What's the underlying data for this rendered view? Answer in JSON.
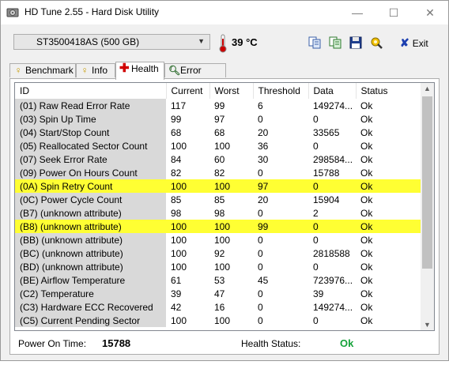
{
  "window": {
    "title": "HD Tune 2.55 - Hard Disk Utility",
    "controls": {
      "minimize": "—",
      "maximize": "☐",
      "close": "✕"
    }
  },
  "toolbar": {
    "drive": "ST3500418AS (500 GB)",
    "temperature": "39 °C",
    "exit_label": "Exit"
  },
  "tabs": [
    {
      "label": "Benchmark",
      "icon": "benchmark-icon"
    },
    {
      "label": "Info",
      "icon": "info-icon"
    },
    {
      "label": "Health",
      "icon": "health-icon",
      "active": true
    },
    {
      "label": "Error Scan",
      "icon": "error-scan-icon"
    }
  ],
  "table": {
    "columns": [
      "ID",
      "Current",
      "Worst",
      "Threshold",
      "Data",
      "Status"
    ],
    "rows": [
      {
        "id": "(01) Raw Read Error Rate",
        "current": "117",
        "worst": "99",
        "threshold": "6",
        "data": "149274...",
        "status": "Ok"
      },
      {
        "id": "(03) Spin Up Time",
        "current": "99",
        "worst": "97",
        "threshold": "0",
        "data": "0",
        "status": "Ok"
      },
      {
        "id": "(04) Start/Stop Count",
        "current": "68",
        "worst": "68",
        "threshold": "20",
        "data": "33565",
        "status": "Ok"
      },
      {
        "id": "(05) Reallocated Sector Count",
        "current": "100",
        "worst": "100",
        "threshold": "36",
        "data": "0",
        "status": "Ok"
      },
      {
        "id": "(07) Seek Error Rate",
        "current": "84",
        "worst": "60",
        "threshold": "30",
        "data": "298584...",
        "status": "Ok"
      },
      {
        "id": "(09) Power On Hours Count",
        "current": "82",
        "worst": "82",
        "threshold": "0",
        "data": "15788",
        "status": "Ok"
      },
      {
        "id": "(0A) Spin Retry Count",
        "current": "100",
        "worst": "100",
        "threshold": "97",
        "data": "0",
        "status": "Ok",
        "highlight": true
      },
      {
        "id": "(0C) Power Cycle Count",
        "current": "85",
        "worst": "85",
        "threshold": "20",
        "data": "15904",
        "status": "Ok"
      },
      {
        "id": "(B7) (unknown attribute)",
        "current": "98",
        "worst": "98",
        "threshold": "0",
        "data": "2",
        "status": "Ok"
      },
      {
        "id": "(B8) (unknown attribute)",
        "current": "100",
        "worst": "100",
        "threshold": "99",
        "data": "0",
        "status": "Ok",
        "highlight": true
      },
      {
        "id": "(BB) (unknown attribute)",
        "current": "100",
        "worst": "100",
        "threshold": "0",
        "data": "0",
        "status": "Ok"
      },
      {
        "id": "(BC) (unknown attribute)",
        "current": "100",
        "worst": "92",
        "threshold": "0",
        "data": "2818588",
        "status": "Ok"
      },
      {
        "id": "(BD) (unknown attribute)",
        "current": "100",
        "worst": "100",
        "threshold": "0",
        "data": "0",
        "status": "Ok"
      },
      {
        "id": "(BE) Airflow Temperature",
        "current": "61",
        "worst": "53",
        "threshold": "45",
        "data": "723976...",
        "status": "Ok"
      },
      {
        "id": "(C2) Temperature",
        "current": "39",
        "worst": "47",
        "threshold": "0",
        "data": "39",
        "status": "Ok"
      },
      {
        "id": "(C3) Hardware ECC Recovered",
        "current": "42",
        "worst": "16",
        "threshold": "0",
        "data": "149274...",
        "status": "Ok"
      },
      {
        "id": "(C5) Current Pending Sector",
        "current": "100",
        "worst": "100",
        "threshold": "0",
        "data": "0",
        "status": "Ok"
      }
    ]
  },
  "footer": {
    "power_on_label": "Power On Time:",
    "power_on_value": "15788",
    "health_label": "Health Status:",
    "health_value": "Ok"
  },
  "colors": {
    "highlight": "#ffff33",
    "id_column": "#d9d9d9",
    "health_ok": "#15a23a",
    "temperature": "#cc0000"
  }
}
